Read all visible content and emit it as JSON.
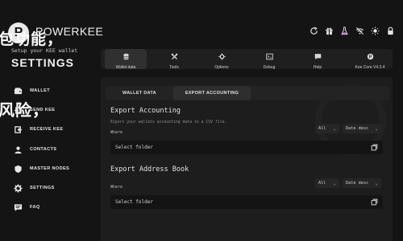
{
  "brand": {
    "logo_letter": "P",
    "name": "POWERKEE",
    "overlay_top": "包功能，",
    "tagline": "Setup your KEE wallet",
    "page_title": "SETTINGS",
    "overlay_mid": "风险，"
  },
  "sidebar": {
    "items": [
      {
        "label": "WALLET",
        "icon": "wallet-icon"
      },
      {
        "label": "SEND KEE",
        "icon": "send-icon"
      },
      {
        "label": "RECEIVE KEE",
        "icon": "receive-icon"
      },
      {
        "label": "CONTACTS",
        "icon": "contacts-icon"
      },
      {
        "label": "MASTER NODES",
        "icon": "shield-icon"
      },
      {
        "label": "SETTINGS",
        "icon": "gear-icon",
        "active": true
      },
      {
        "label": "FAQ",
        "icon": "chat-icon"
      }
    ]
  },
  "top_icons": [
    "refresh-icon",
    "gift-icon",
    "flask-icon",
    "no-signal-icon",
    "sun-icon",
    "lock-icon"
  ],
  "tabs": [
    {
      "label": "Wallet data",
      "icon": "database-icon",
      "active": true
    },
    {
      "label": "Tools",
      "icon": "tools-icon"
    },
    {
      "label": "Options",
      "icon": "options-icon"
    },
    {
      "label": "Debug",
      "icon": "terminal-icon"
    },
    {
      "label": "Help",
      "icon": "help-icon"
    },
    {
      "label": "Kee Core V4.3.4",
      "icon": "logo-icon"
    }
  ],
  "subtabs": [
    {
      "label": "WALLET DATA"
    },
    {
      "label": "EXPORT ACCOUNTING",
      "active": true
    }
  ],
  "export_accounting": {
    "title": "Export Accounting",
    "description": "Export your wallets accounting data to a CSV file.",
    "where_label": "Where",
    "filter_value": "All",
    "sort_value": "Date desc",
    "folder_placeholder": "Select folder"
  },
  "export_address_book": {
    "title": "Export Address Book",
    "where_label": "Where",
    "filter_value": "All",
    "sort_value": "Date desc",
    "folder_placeholder": "Select folder"
  },
  "colors": {
    "background": "#141414",
    "panel": "#1d1d1d",
    "text": "#d6d6d6"
  }
}
